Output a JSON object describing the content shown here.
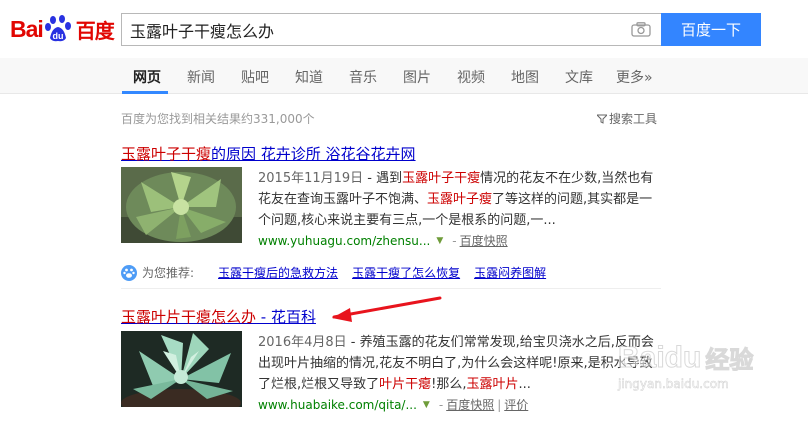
{
  "logo": {
    "bai": "Bai",
    "du": "du",
    "cn": "百度"
  },
  "search": {
    "value": "玉露叶子干瘦怎么办",
    "button": "百度一下"
  },
  "nav": {
    "items": [
      "网页",
      "新闻",
      "贴吧",
      "知道",
      "音乐",
      "图片",
      "视频",
      "地图",
      "文库",
      "更多»"
    ]
  },
  "stats": "百度为您找到相关结果约331,000个",
  "tools": "搜索工具",
  "results": [
    {
      "title_hl": "玉露叶子干瘦",
      "title_rest": "的原因 花卉诊所 浴花谷花卉网",
      "date": "2015年11月19日",
      "abstract_a": " - 遇到",
      "hl_1": "玉露叶子干瘦",
      "abstract_b": "情况的花友不在少数,当然也有花友在查询玉露叶子不饱满、",
      "hl_2": "玉露叶子瘦",
      "abstract_c": "了等这样的问题,其实都是一个问题,核心来说主要有三点,一个是根系的问题,一...",
      "url": "www.yuhuagu.com/zhensu...",
      "snapshot": "百度快照"
    },
    {
      "title_hl": "玉露叶片干瘪怎么办",
      "title_rest": " - 花百科",
      "date": "2016年4月8日",
      "abstract_a": " - 养殖玉露的花友们常常发现,给宝贝浇水之后,反而会出现叶片抽缩的情况,花友不明白了,为什么会这样呢!原来,是积水导致了烂根,烂根又导致了",
      "hl_1": "叶片干瘪",
      "abstract_b": "!那么,",
      "hl_2": "玉露叶片",
      "abstract_c": "...",
      "url": "www.huabaike.com/qita/...",
      "snapshot": "百度快照",
      "review": "评价"
    }
  ],
  "recommend": {
    "label": "为您推荐:",
    "links": [
      "玉露干瘦后的急救方法",
      "玉露干瘦了怎么恢复",
      "玉露闷养图解"
    ]
  },
  "watermark": {
    "brand": "Baidu",
    "cn": "经验",
    "url": "jingyan.baidu.com"
  },
  "colors": {
    "brand_red": "#e10602",
    "link_blue": "#0000cc",
    "highlight_red": "#cc0000",
    "url_green": "#008000",
    "button_blue": "#3385ff"
  }
}
